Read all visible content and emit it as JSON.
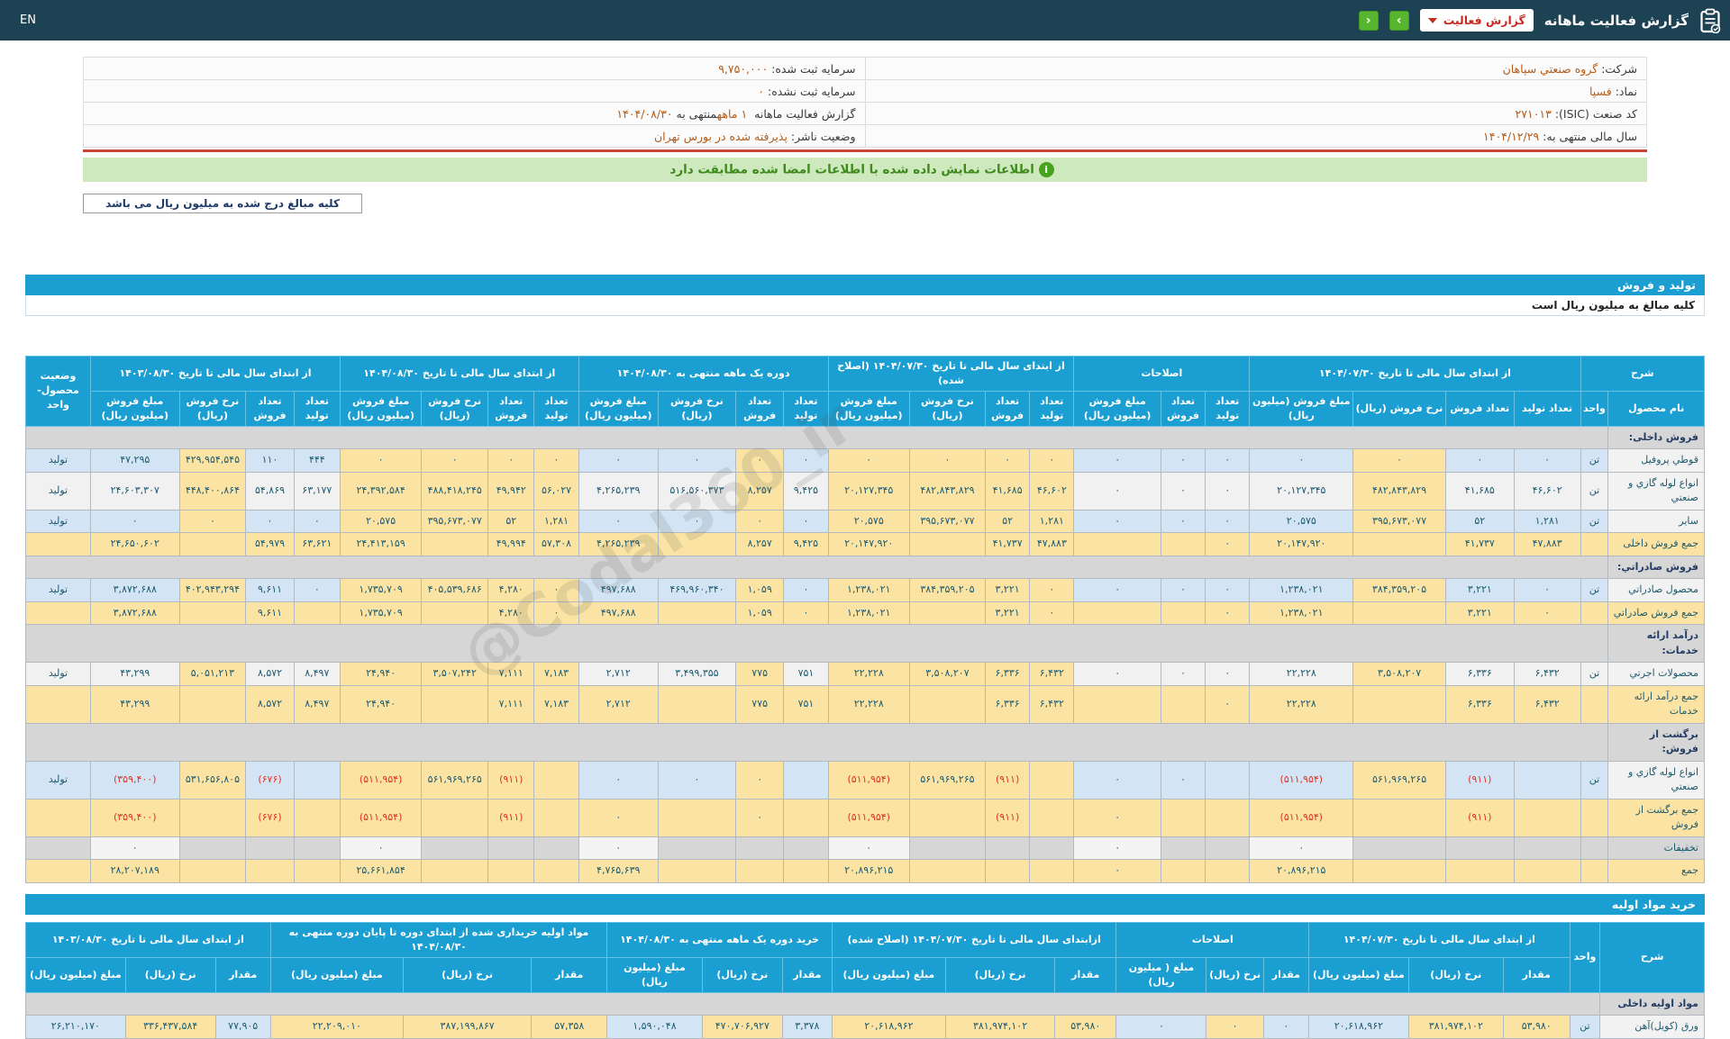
{
  "app": {
    "title": "گزارش فعالیت ماهانه",
    "report_button": "گزارش فعالیت",
    "lang_link": "EN",
    "prev_arrow": "‹",
    "next_arrow": "›"
  },
  "info": {
    "right": [
      {
        "label": "شرکت:",
        "value": "گروه صنعتي سپاهان"
      },
      {
        "label": "نماد:",
        "value": "فسپا"
      },
      {
        "label": "کد صنعت (ISIC):",
        "value": "۲۷۱۰۱۳"
      },
      {
        "label": "سال مالی منتهی به:",
        "value": "۱۴۰۴/۱۲/۲۹"
      }
    ],
    "left": [
      {
        "label": "سرمایه ثبت شده:",
        "value": "۹,۷۵۰,۰۰۰"
      },
      {
        "label": "سرمایه ثبت نشده:",
        "value": "۰"
      },
      {
        "parts": [
          {
            "t": "گزارش فعالیت ماهانه "
          },
          {
            "t": "۱ ماهه",
            "hl": true
          },
          {
            "t": "منتهی به"
          },
          {
            "t": "۱۴۰۴/۰۸/۳۰",
            "hl": true
          }
        ]
      },
      {
        "label": "وضعیت ناشر:",
        "value": "پذیرفته شده در بورس تهران"
      }
    ]
  },
  "notice": "اطلاعات نمایش داده شده با اطلاعات امضا شده مطابقت دارد",
  "notice_icon": "i",
  "unit_note_box": "کلیه مبالغ درج شده به میلیون ریال می باشد",
  "watermark": "@Codal360_ir",
  "sales": {
    "section_title": "تولید و فروش",
    "unit_note": "کلیه مبالغ به میلیون ریال است",
    "lead": {
      "top": "شرح",
      "cols": [
        "نام محصول",
        "واحد"
      ]
    },
    "groups": [
      {
        "title": "از ابتدای سال مالی تا تاریخ ۱۴۰۴/۰۷/۳۰",
        "cols": [
          "تعداد تولید",
          "تعداد فروش",
          "نرخ فروش (ریال)",
          "مبلغ فروش (میلیون ریال)"
        ]
      },
      {
        "title": "اصلاحات",
        "cols": [
          "تعداد تولید",
          "تعداد فروش",
          "مبلغ فروش (میلیون ریال)"
        ]
      },
      {
        "title": "از ابتدای سال مالی تا تاریخ ۱۴۰۴/۰۷/۳۰ (اصلاح شده)",
        "cols": [
          "تعداد تولید",
          "تعداد فروش",
          "نرخ فروش (ریال)",
          "مبلغ فروش (میلیون ریال)"
        ]
      },
      {
        "title": "دوره یک ماهه منتهی به ۱۴۰۴/۰۸/۳۰",
        "cols": [
          "تعداد تولید",
          "تعداد فروش",
          "نرخ فروش (ریال)",
          "مبلغ فروش (میلیون ریال)"
        ]
      },
      {
        "title": "از ابتدای سال مالی تا تاریخ ۱۴۰۴/۰۸/۳۰",
        "cols": [
          "تعداد تولید",
          "تعداد فروش",
          "نرخ فروش (ریال)",
          "مبلغ فروش (میلیون ریال)"
        ]
      },
      {
        "title": "از ابتدای سال مالی تا تاریخ ۱۴۰۳/۰۸/۳۰",
        "cols": [
          "تعداد تولید",
          "تعداد فروش",
          "نرخ فروش (ریال)",
          "مبلغ فروش (میلیون ریال)"
        ]
      }
    ],
    "tail": "وضعیت محصول-واحد",
    "rows": [
      {
        "type": "group",
        "name": "فروش داخلی:"
      },
      {
        "type": "data",
        "alt": "bl",
        "name": "قوطي پروفيل",
        "unit": "تن",
        "status": "تولید",
        "cells": [
          "۰",
          "۰",
          "۰",
          "۰",
          "۰",
          "۰",
          "۰",
          "۰",
          "۰",
          "۰",
          "۰",
          "۰",
          "۰",
          "۰",
          "۰",
          "۰",
          "۰",
          "۰",
          "۰",
          "۴۴۴",
          "۱۱۰",
          "۴۲۹,۹۵۴,۵۴۵",
          "۴۷,۲۹۵"
        ]
      },
      {
        "type": "data",
        "alt": "wh",
        "name": "انواع لوله گازي و صنعتي",
        "unit": "تن",
        "status": "تولید",
        "cells": [
          "۴۶,۶۰۲",
          "۴۱,۶۸۵",
          "۴۸۲,۸۴۳,۸۲۹",
          "۲۰,۱۲۷,۳۴۵",
          "۰",
          "۰",
          "۰",
          "۴۶,۶۰۲",
          "۴۱,۶۸۵",
          "۴۸۲,۸۴۳,۸۲۹",
          "۲۰,۱۲۷,۳۴۵",
          "۹,۴۲۵",
          "۸,۲۵۷",
          "۵۱۶,۵۶۰,۳۷۳",
          "۴,۲۶۵,۲۳۹",
          "۵۶,۰۲۷",
          "۴۹,۹۴۲",
          "۴۸۸,۴۱۸,۲۴۵",
          "۲۴,۳۹۲,۵۸۴",
          "۶۳,۱۷۷",
          "۵۴,۸۶۹",
          "۴۴۸,۴۰۰,۸۶۴",
          "۲۴,۶۰۳,۳۰۷"
        ]
      },
      {
        "type": "data",
        "alt": "bl",
        "name": "سایر",
        "unit": "تن",
        "status": "تولید",
        "cells": [
          "۱,۲۸۱",
          "۵۲",
          "۳۹۵,۶۷۳,۰۷۷",
          "۲۰,۵۷۵",
          "۰",
          "۰",
          "۰",
          "۱,۲۸۱",
          "۵۲",
          "۳۹۵,۶۷۳,۰۷۷",
          "۲۰,۵۷۵",
          "۰",
          "۰",
          "۰",
          "۰",
          "۱,۲۸۱",
          "۵۲",
          "۳۹۵,۶۷۳,۰۷۷",
          "۲۰,۵۷۵",
          "۰",
          "۰",
          "۰",
          "۰"
        ]
      },
      {
        "type": "total",
        "name": "جمع فروش داخلی",
        "cells": [
          "۴۷,۸۸۳",
          "۴۱,۷۳۷",
          "",
          "۲۰,۱۴۷,۹۲۰",
          "۰",
          "",
          "",
          "۴۷,۸۸۳",
          "۴۱,۷۳۷",
          "",
          "۲۰,۱۴۷,۹۲۰",
          "۹,۴۲۵",
          "۸,۲۵۷",
          "",
          "۴,۲۶۵,۲۳۹",
          "۵۷,۳۰۸",
          "۴۹,۹۹۴",
          "",
          "۲۴,۴۱۳,۱۵۹",
          "۶۳,۶۲۱",
          "۵۴,۹۷۹",
          "",
          "۲۴,۶۵۰,۶۰۲"
        ]
      },
      {
        "type": "group",
        "name": "فروش صادراتي:"
      },
      {
        "type": "data",
        "alt": "bl",
        "name": "محصول صادراتي",
        "unit": "تن",
        "status": "تولید",
        "cells": [
          "۰",
          "۳,۲۲۱",
          "۳۸۴,۳۵۹,۲۰۵",
          "۱,۲۳۸,۰۲۱",
          "۰",
          "۰",
          "۰",
          "۰",
          "۳,۲۲۱",
          "۳۸۴,۳۵۹,۲۰۵",
          "۱,۲۳۸,۰۲۱",
          "۰",
          "۱,۰۵۹",
          "۴۶۹,۹۶۰,۳۴۰",
          "۴۹۷,۶۸۸",
          "۰",
          "۴,۲۸۰",
          "۴۰۵,۵۳۹,۶۸۶",
          "۱,۷۳۵,۷۰۹",
          "۰",
          "۹,۶۱۱",
          "۴۰۲,۹۴۳,۲۹۴",
          "۳,۸۷۲,۶۸۸"
        ]
      },
      {
        "type": "total",
        "name": "جمع فروش صادراتي",
        "cells": [
          "۰",
          "۳,۲۲۱",
          "",
          "۱,۲۳۸,۰۲۱",
          "۰",
          "",
          "",
          "۰",
          "۳,۲۲۱",
          "",
          "۱,۲۳۸,۰۲۱",
          "۰",
          "۱,۰۵۹",
          "",
          "۴۹۷,۶۸۸",
          "۰",
          "۴,۲۸۰",
          "",
          "۱,۷۳۵,۷۰۹",
          "",
          "۹,۶۱۱",
          "",
          "۳,۸۷۲,۶۸۸"
        ]
      },
      {
        "type": "group",
        "name": "درآمد ارائه خدمات:"
      },
      {
        "type": "data",
        "alt": "wh",
        "name": "محصولات اجرتي",
        "unit": "تن",
        "status": "تولید",
        "cells": [
          "۶,۴۳۲",
          "۶,۳۳۶",
          "۳,۵۰۸,۲۰۷",
          "۲۲,۲۲۸",
          "۰",
          "۰",
          "۰",
          "۶,۴۳۲",
          "۶,۳۳۶",
          "۳,۵۰۸,۲۰۷",
          "۲۲,۲۲۸",
          "۷۵۱",
          "۷۷۵",
          "۳,۴۹۹,۳۵۵",
          "۲,۷۱۲",
          "۷,۱۸۳",
          "۷,۱۱۱",
          "۳,۵۰۷,۲۴۲",
          "۲۴,۹۴۰",
          "۸,۴۹۷",
          "۸,۵۷۲",
          "۵,۰۵۱,۲۱۳",
          "۴۳,۲۹۹"
        ]
      },
      {
        "type": "total",
        "name": "جمع درآمد ارائه خدمات",
        "cells": [
          "۶,۴۳۲",
          "۶,۳۳۶",
          "",
          "۲۲,۲۲۸",
          "۰",
          "",
          "",
          "۶,۴۳۲",
          "۶,۳۳۶",
          "",
          "۲۲,۲۲۸",
          "۷۵۱",
          "۷۷۵",
          "",
          "۲,۷۱۲",
          "۷,۱۸۳",
          "۷,۱۱۱",
          "",
          "۲۴,۹۴۰",
          "۸,۴۹۷",
          "۸,۵۷۲",
          "",
          "۴۳,۲۹۹"
        ]
      },
      {
        "type": "group",
        "name": "برگشت از فروش:"
      },
      {
        "type": "data",
        "alt": "bl",
        "name": "انواع لوله گازي و صنعتي",
        "unit": "تن",
        "status": "تولید",
        "cells": [
          "",
          "(۹۱۱)",
          "۵۶۱,۹۶۹,۲۶۵",
          "(۵۱۱,۹۵۴)",
          "",
          "۰",
          "۰",
          "",
          "(۹۱۱)",
          "۵۶۱,۹۶۹,۲۶۵",
          "(۵۱۱,۹۵۴)",
          "",
          "۰",
          "۰",
          "۰",
          "",
          "(۹۱۱)",
          "۵۶۱,۹۶۹,۲۶۵",
          "(۵۱۱,۹۵۴)",
          "",
          "(۶۷۶)",
          "۵۳۱,۶۵۶,۸۰۵",
          "(۳۵۹,۴۰۰)"
        ]
      },
      {
        "type": "total",
        "name": "جمع برگشت از فروش",
        "cells": [
          "",
          "(۹۱۱)",
          "",
          "(۵۱۱,۹۵۴)",
          "",
          "",
          "۰",
          "",
          "(۹۱۱)",
          "",
          "(۵۱۱,۹۵۴)",
          "",
          "۰",
          "",
          "۰",
          "",
          "(۹۱۱)",
          "",
          "(۵۱۱,۹۵۴)",
          "",
          "(۶۷۶)",
          "",
          "(۳۵۹,۴۰۰)"
        ]
      },
      {
        "type": "discount",
        "name": "تخفیفات",
        "cells": [
          "",
          "",
          "",
          "۰",
          "",
          "",
          "۰",
          "",
          "",
          "",
          "۰",
          "",
          "",
          "",
          "۰",
          "",
          "",
          "",
          "۰",
          "",
          "",
          "",
          "۰"
        ]
      },
      {
        "type": "grand",
        "name": "جمع",
        "cells": [
          "",
          "",
          "",
          "۲۰,۸۹۶,۲۱۵",
          "",
          "",
          "۰",
          "",
          "",
          "",
          "۲۰,۸۹۶,۲۱۵",
          "",
          "",
          "",
          "۴,۷۶۵,۶۳۹",
          "",
          "",
          "",
          "۲۵,۶۶۱,۸۵۴",
          "",
          "",
          "",
          "۲۸,۲۰۷,۱۸۹"
        ]
      }
    ]
  },
  "purchases": {
    "section_title": "خرید مواد اولیه",
    "lead": {
      "rowspan": [
        "شرح",
        "واحد"
      ]
    },
    "groups": [
      {
        "title": "از ابتدای سال مالی تا تاریخ ۱۴۰۴/۰۷/۳۰",
        "cols": [
          "مقدار",
          "نرخ (ریال)",
          "مبلغ (میلیون ریال)"
        ]
      },
      {
        "title": "اصلاحات",
        "cols": [
          "مقدار",
          "نرخ (ریال)",
          "مبلغ ( میلیون ریال)"
        ]
      },
      {
        "title": "ازابتدای سال مالی تا تاریخ ۱۴۰۴/۰۷/۳۰ (اصلاح شده)",
        "cols": [
          "مقدار",
          "نرخ (ریال)",
          "مبلغ (میلیون ریال)"
        ]
      },
      {
        "title": "خرید دوره یک ماهه منتهی به ۱۴۰۴/۰۸/۳۰",
        "cols": [
          "مقدار",
          "نرخ (ریال)",
          "مبلغ (میلیون ریال)"
        ]
      },
      {
        "title": "مواد اولیه خریداری شده از ابتدای دوره تا پایان دوره منتهی به ۱۴۰۴/۰۸/۳۰",
        "cols": [
          "مقدار",
          "نرخ (ریال)",
          "مبلغ (میلیون ریال)"
        ]
      },
      {
        "title": "از ابتدای سال مالی تا تاریخ ۱۴۰۳/۰۸/۳۰",
        "cols": [
          "مقدار",
          "نرخ (ریال)",
          "مبلغ (میلیون ریال)"
        ]
      }
    ],
    "rows": [
      {
        "type": "group",
        "name": "مواد اولیه داخلی"
      },
      {
        "type": "data",
        "alt": "bl",
        "name": "ورق (کویل)آهن",
        "unit": "تن",
        "cells": [
          "۵۳,۹۸۰",
          "۳۸۱,۹۷۴,۱۰۲",
          "۲۰,۶۱۸,۹۶۲",
          "۰",
          "۰",
          "۰",
          "۵۳,۹۸۰",
          "۳۸۱,۹۷۴,۱۰۲",
          "۲۰,۶۱۸,۹۶۲",
          "۳,۳۷۸",
          "۴۷۰,۷۰۶,۹۲۷",
          "۱,۵۹۰,۰۴۸",
          "۵۷,۳۵۸",
          "۳۸۷,۱۹۹,۸۶۷",
          "۲۲,۲۰۹,۰۱۰",
          "۷۷,۹۰۵",
          "۳۳۶,۴۳۷,۵۸۴",
          "۲۶,۲۱۰,۱۷۰"
        ]
      }
    ]
  }
}
